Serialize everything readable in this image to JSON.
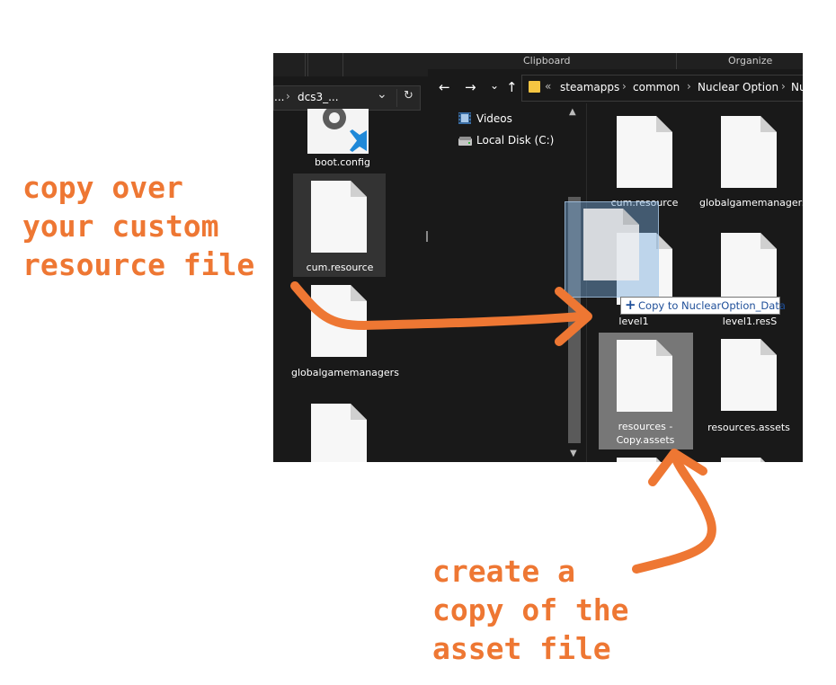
{
  "annotations": {
    "top_note": "copy over\nyour custom\nresource file",
    "bottom_note": "create a\ncopy of the\nasset file"
  },
  "left_window": {
    "address": {
      "prefix": "...",
      "sep": "›",
      "folder": "dcs3_...",
      "chevron": "⌄",
      "refresh": "↻"
    },
    "files": [
      {
        "name": "boot.config"
      },
      {
        "name": "cum.resource",
        "selected": true
      },
      {
        "name": "globalgamemanagers"
      }
    ]
  },
  "right_window": {
    "ribbon": {
      "clipboard": "Clipboard",
      "organize": "Organize"
    },
    "nav": {
      "back": "←",
      "forward": "→",
      "recent": "⌄",
      "up": "↑"
    },
    "breadcrumb": {
      "overflow": "«",
      "items": [
        "steamapps",
        "common",
        "Nuclear Option",
        "Nu"
      ]
    },
    "sidebar": [
      {
        "label": "Videos",
        "icon": "video-icon"
      },
      {
        "label": "Local Disk (C:)",
        "icon": "drive-icon"
      }
    ],
    "files": [
      {
        "name": "cum.resource"
      },
      {
        "name": "globalgamemanagers"
      },
      {
        "name": "level1"
      },
      {
        "name": "level1.resS"
      },
      {
        "name": "resources - Copy.assets",
        "selected": true
      },
      {
        "name": "resources.assets"
      }
    ],
    "drag_tooltip": {
      "plus": "+",
      "text": "Copy to NuclearOption_Data"
    }
  },
  "colors": {
    "accent": "#ee7733",
    "explorer_bg": "#191919",
    "selection": "#777777"
  }
}
